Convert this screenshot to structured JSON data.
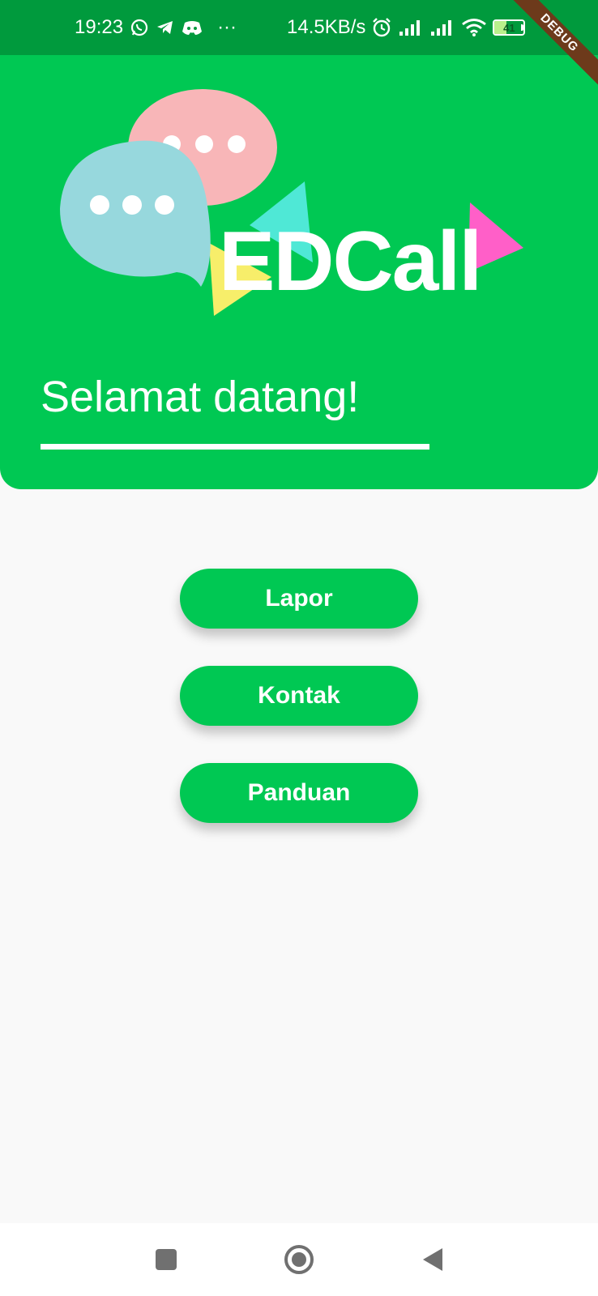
{
  "status_bar": {
    "time": "19:23",
    "overflow": "···",
    "network_speed": "14.5KB/s",
    "battery_level": "41",
    "battery_fraction": 0.41,
    "left_icons": [
      "whatsapp-icon",
      "telegram-icon",
      "discord-icon"
    ],
    "right_icons": [
      "alarm-icon",
      "signal-icon",
      "signal-icon",
      "wifi-icon",
      "battery-icon"
    ]
  },
  "debug_banner": "DEBUG",
  "header": {
    "logo_text": "EDCall",
    "welcome": "Selamat datang!"
  },
  "menu": {
    "buttons": [
      {
        "label": "Lapor"
      },
      {
        "label": "Kontak"
      },
      {
        "label": "Panduan"
      }
    ]
  },
  "nav": {
    "icons": [
      "recent-apps-icon",
      "home-icon",
      "back-icon"
    ]
  },
  "colors": {
    "primary": "#00c853",
    "status_bar": "#009a3d",
    "background": "#f9f9f9",
    "bubble_pink": "#f8b6b8",
    "bubble_blue": "#97d8dd",
    "accent_yellow": "#f7ee6a",
    "accent_cyan": "#4fe8d6",
    "accent_magenta": "#ff5fc8"
  }
}
